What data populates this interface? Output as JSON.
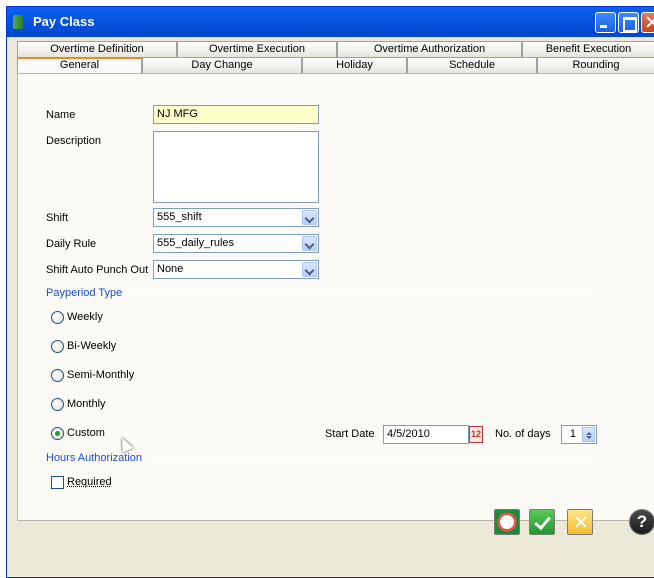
{
  "window": {
    "title": "Pay Class"
  },
  "tabs_row1": [
    "Overtime Definition",
    "Overtime Execution",
    "Overtime Authorization",
    "Benefit Execution"
  ],
  "tabs_row2": [
    "General",
    "Day Change",
    "Holiday",
    "Schedule",
    "Rounding"
  ],
  "active_tab": "General",
  "form": {
    "name_label": "Name",
    "name_value": "NJ MFG",
    "description_label": "Description",
    "description_value": "",
    "shift_label": "Shift",
    "shift_value": "555_shift",
    "daily_rule_label": "Daily Rule",
    "daily_rule_value": "555_daily_rules",
    "auto_punch_label": "Shift Auto Punch Out",
    "auto_punch_value": "None"
  },
  "payperiod": {
    "section_label": "Payperiod Type",
    "options": [
      "Weekly",
      "Bi-Weekly",
      "Semi-Monthly",
      "Monthly",
      "Custom"
    ],
    "selected": "Custom",
    "start_date_label": "Start Date",
    "start_date_value": "4/5/2010",
    "calendar_glyph": "12",
    "num_days_label": "No. of days",
    "num_days_value": "1"
  },
  "hours_auth": {
    "section_label": "Hours Authorization",
    "required_label": "Required",
    "required_checked": false
  },
  "footer": {
    "help_glyph": "?"
  },
  "colors": {
    "title_bar": "#0755e0",
    "section_text": "#1a4fd0",
    "active_tab_accent": "#e68b2c",
    "name_field_bg": "#ffffcc"
  }
}
